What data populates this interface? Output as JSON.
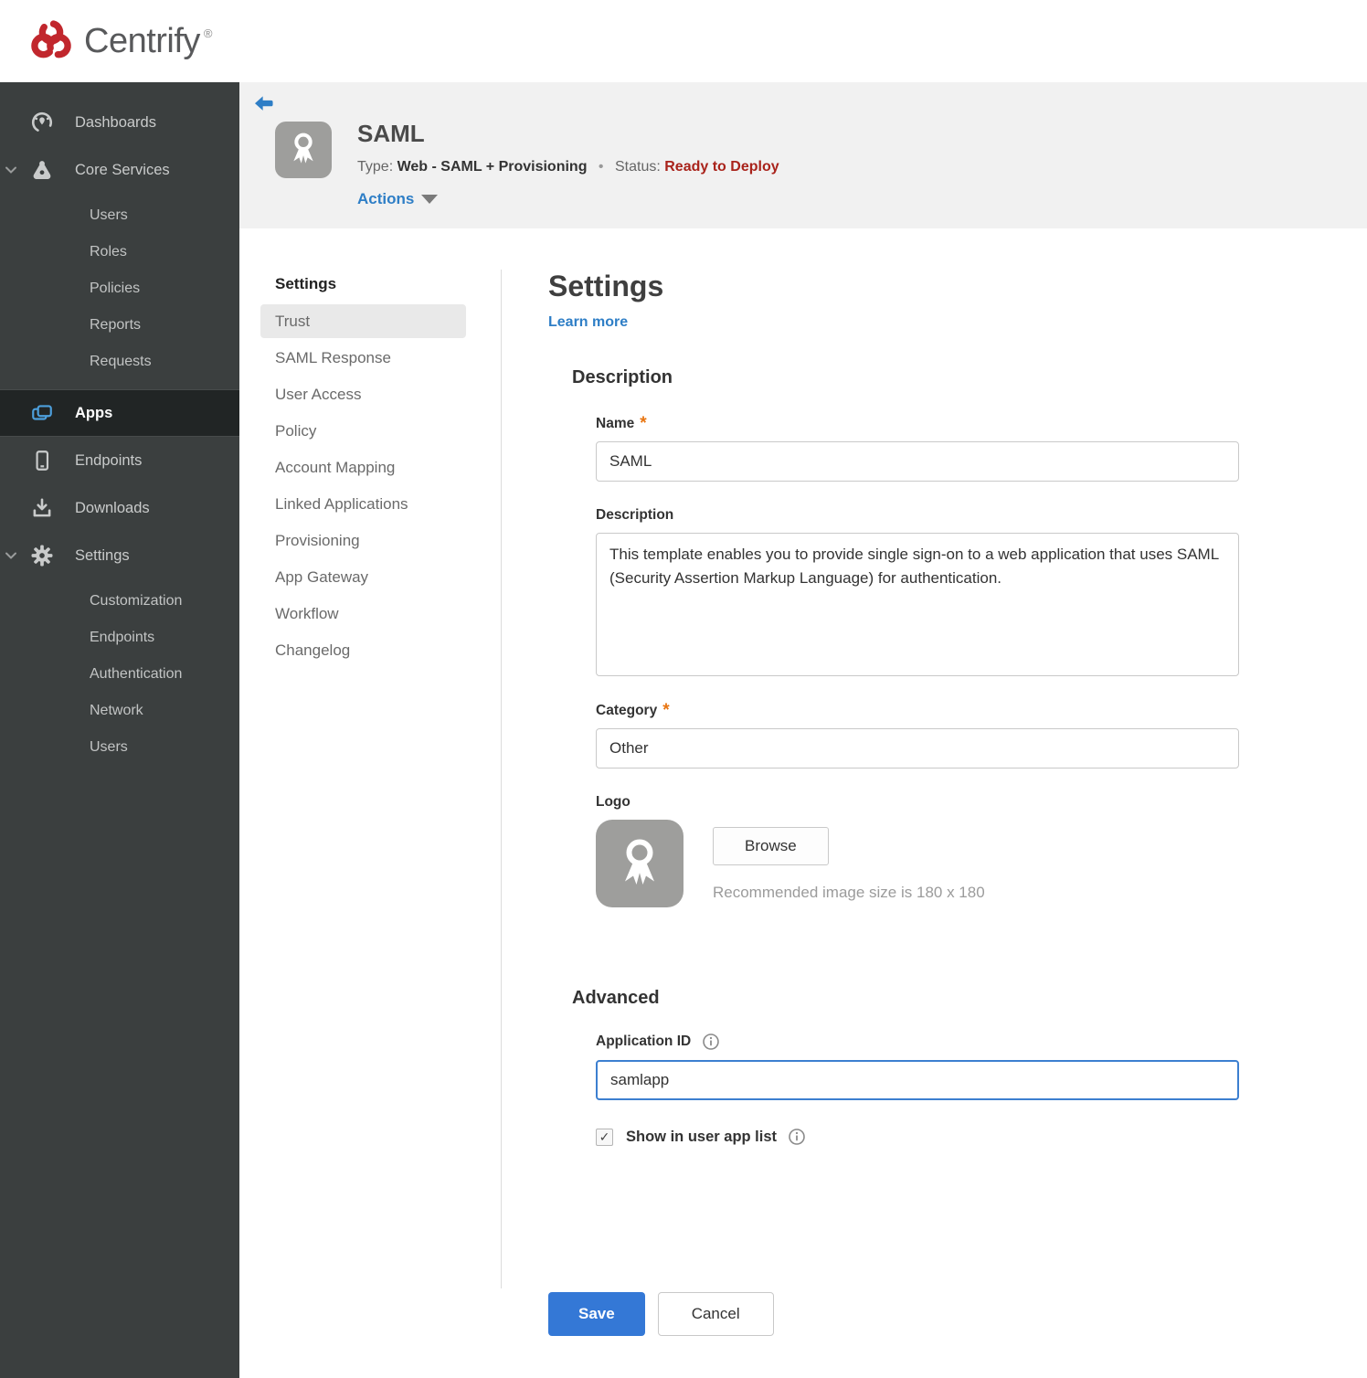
{
  "brand": {
    "name": "Centrify",
    "registered": "®"
  },
  "sidebar": {
    "items": [
      {
        "label": "Dashboards"
      },
      {
        "label": "Core Services"
      },
      {
        "label": "Apps"
      },
      {
        "label": "Endpoints"
      },
      {
        "label": "Downloads"
      },
      {
        "label": "Settings"
      }
    ],
    "core_children": [
      "Users",
      "Roles",
      "Policies",
      "Reports",
      "Requests"
    ],
    "settings_children": [
      "Customization",
      "Endpoints",
      "Authentication",
      "Network",
      "Users"
    ]
  },
  "header": {
    "title": "SAML",
    "type_label": "Type:",
    "type_value": "Web - SAML + Provisioning",
    "dot": "•",
    "status_label": "Status:",
    "status_value": "Ready to Deploy",
    "actions_label": "Actions"
  },
  "subnav": {
    "heading": "Settings",
    "selected": "Trust",
    "items": [
      "Trust",
      "SAML Response",
      "User Access",
      "Policy",
      "Account Mapping",
      "Linked Applications",
      "Provisioning",
      "App Gateway",
      "Workflow",
      "Changelog"
    ]
  },
  "form": {
    "page_title": "Settings",
    "learn_more": "Learn more",
    "description_section": "Description",
    "required_marker": "*",
    "name_label": "Name",
    "name_value": "SAML",
    "description_label": "Description",
    "description_value": "This template enables you to provide single sign-on to a web application that uses SAML (Security Assertion Markup Language) for authentication.",
    "category_label": "Category",
    "category_value": "Other",
    "logo_label": "Logo",
    "browse_button": "Browse",
    "logo_hint": "Recommended image size is 180 x 180",
    "advanced_section": "Advanced",
    "application_id_label": "Application ID",
    "application_id_value": "samlapp",
    "show_in_app_list_label": "Show in user app list",
    "show_in_app_list_checked": true,
    "save_button": "Save",
    "cancel_button": "Cancel"
  },
  "colors": {
    "accent_blue": "#3478d6",
    "link_blue": "#2e7ec6",
    "status_red": "#a9231b",
    "required_orange": "#e87511",
    "sidebar_bg": "#3b3f3f",
    "sidebar_selected_bg": "#212525",
    "apps_icon_blue": "#4da0dd",
    "header_band": "#f1f1f1"
  }
}
